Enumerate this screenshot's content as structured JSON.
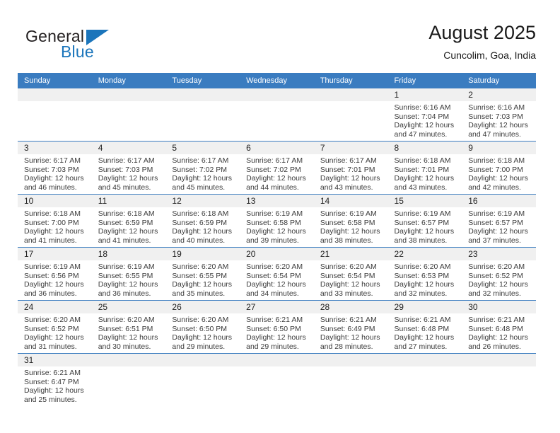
{
  "logo": {
    "word1": "General",
    "word2": "Blue",
    "flag_icon": "blue-triangle-flag-icon",
    "accent_color": "#1b75bb"
  },
  "header": {
    "title": "August 2025",
    "location": "Cuncolim, Goa, India"
  },
  "calendar": {
    "header_bg": "#3a7cc0",
    "daynum_bg": "#f0f0f0",
    "weekdays": [
      "Sunday",
      "Monday",
      "Tuesday",
      "Wednesday",
      "Thursday",
      "Friday",
      "Saturday"
    ],
    "weeks": [
      [
        {
          "day": "",
          "sunrise": "",
          "sunset": "",
          "daylight1": "",
          "daylight2": ""
        },
        {
          "day": "",
          "sunrise": "",
          "sunset": "",
          "daylight1": "",
          "daylight2": ""
        },
        {
          "day": "",
          "sunrise": "",
          "sunset": "",
          "daylight1": "",
          "daylight2": ""
        },
        {
          "day": "",
          "sunrise": "",
          "sunset": "",
          "daylight1": "",
          "daylight2": ""
        },
        {
          "day": "",
          "sunrise": "",
          "sunset": "",
          "daylight1": "",
          "daylight2": ""
        },
        {
          "day": "1",
          "sunrise": "Sunrise: 6:16 AM",
          "sunset": "Sunset: 7:04 PM",
          "daylight1": "Daylight: 12 hours",
          "daylight2": "and 47 minutes."
        },
        {
          "day": "2",
          "sunrise": "Sunrise: 6:16 AM",
          "sunset": "Sunset: 7:03 PM",
          "daylight1": "Daylight: 12 hours",
          "daylight2": "and 47 minutes."
        }
      ],
      [
        {
          "day": "3",
          "sunrise": "Sunrise: 6:17 AM",
          "sunset": "Sunset: 7:03 PM",
          "daylight1": "Daylight: 12 hours",
          "daylight2": "and 46 minutes."
        },
        {
          "day": "4",
          "sunrise": "Sunrise: 6:17 AM",
          "sunset": "Sunset: 7:03 PM",
          "daylight1": "Daylight: 12 hours",
          "daylight2": "and 45 minutes."
        },
        {
          "day": "5",
          "sunrise": "Sunrise: 6:17 AM",
          "sunset": "Sunset: 7:02 PM",
          "daylight1": "Daylight: 12 hours",
          "daylight2": "and 45 minutes."
        },
        {
          "day": "6",
          "sunrise": "Sunrise: 6:17 AM",
          "sunset": "Sunset: 7:02 PM",
          "daylight1": "Daylight: 12 hours",
          "daylight2": "and 44 minutes."
        },
        {
          "day": "7",
          "sunrise": "Sunrise: 6:17 AM",
          "sunset": "Sunset: 7:01 PM",
          "daylight1": "Daylight: 12 hours",
          "daylight2": "and 43 minutes."
        },
        {
          "day": "8",
          "sunrise": "Sunrise: 6:18 AM",
          "sunset": "Sunset: 7:01 PM",
          "daylight1": "Daylight: 12 hours",
          "daylight2": "and 43 minutes."
        },
        {
          "day": "9",
          "sunrise": "Sunrise: 6:18 AM",
          "sunset": "Sunset: 7:00 PM",
          "daylight1": "Daylight: 12 hours",
          "daylight2": "and 42 minutes."
        }
      ],
      [
        {
          "day": "10",
          "sunrise": "Sunrise: 6:18 AM",
          "sunset": "Sunset: 7:00 PM",
          "daylight1": "Daylight: 12 hours",
          "daylight2": "and 41 minutes."
        },
        {
          "day": "11",
          "sunrise": "Sunrise: 6:18 AM",
          "sunset": "Sunset: 6:59 PM",
          "daylight1": "Daylight: 12 hours",
          "daylight2": "and 41 minutes."
        },
        {
          "day": "12",
          "sunrise": "Sunrise: 6:18 AM",
          "sunset": "Sunset: 6:59 PM",
          "daylight1": "Daylight: 12 hours",
          "daylight2": "and 40 minutes."
        },
        {
          "day": "13",
          "sunrise": "Sunrise: 6:19 AM",
          "sunset": "Sunset: 6:58 PM",
          "daylight1": "Daylight: 12 hours",
          "daylight2": "and 39 minutes."
        },
        {
          "day": "14",
          "sunrise": "Sunrise: 6:19 AM",
          "sunset": "Sunset: 6:58 PM",
          "daylight1": "Daylight: 12 hours",
          "daylight2": "and 38 minutes."
        },
        {
          "day": "15",
          "sunrise": "Sunrise: 6:19 AM",
          "sunset": "Sunset: 6:57 PM",
          "daylight1": "Daylight: 12 hours",
          "daylight2": "and 38 minutes."
        },
        {
          "day": "16",
          "sunrise": "Sunrise: 6:19 AM",
          "sunset": "Sunset: 6:57 PM",
          "daylight1": "Daylight: 12 hours",
          "daylight2": "and 37 minutes."
        }
      ],
      [
        {
          "day": "17",
          "sunrise": "Sunrise: 6:19 AM",
          "sunset": "Sunset: 6:56 PM",
          "daylight1": "Daylight: 12 hours",
          "daylight2": "and 36 minutes."
        },
        {
          "day": "18",
          "sunrise": "Sunrise: 6:19 AM",
          "sunset": "Sunset: 6:55 PM",
          "daylight1": "Daylight: 12 hours",
          "daylight2": "and 36 minutes."
        },
        {
          "day": "19",
          "sunrise": "Sunrise: 6:20 AM",
          "sunset": "Sunset: 6:55 PM",
          "daylight1": "Daylight: 12 hours",
          "daylight2": "and 35 minutes."
        },
        {
          "day": "20",
          "sunrise": "Sunrise: 6:20 AM",
          "sunset": "Sunset: 6:54 PM",
          "daylight1": "Daylight: 12 hours",
          "daylight2": "and 34 minutes."
        },
        {
          "day": "21",
          "sunrise": "Sunrise: 6:20 AM",
          "sunset": "Sunset: 6:54 PM",
          "daylight1": "Daylight: 12 hours",
          "daylight2": "and 33 minutes."
        },
        {
          "day": "22",
          "sunrise": "Sunrise: 6:20 AM",
          "sunset": "Sunset: 6:53 PM",
          "daylight1": "Daylight: 12 hours",
          "daylight2": "and 32 minutes."
        },
        {
          "day": "23",
          "sunrise": "Sunrise: 6:20 AM",
          "sunset": "Sunset: 6:52 PM",
          "daylight1": "Daylight: 12 hours",
          "daylight2": "and 32 minutes."
        }
      ],
      [
        {
          "day": "24",
          "sunrise": "Sunrise: 6:20 AM",
          "sunset": "Sunset: 6:52 PM",
          "daylight1": "Daylight: 12 hours",
          "daylight2": "and 31 minutes."
        },
        {
          "day": "25",
          "sunrise": "Sunrise: 6:20 AM",
          "sunset": "Sunset: 6:51 PM",
          "daylight1": "Daylight: 12 hours",
          "daylight2": "and 30 minutes."
        },
        {
          "day": "26",
          "sunrise": "Sunrise: 6:20 AM",
          "sunset": "Sunset: 6:50 PM",
          "daylight1": "Daylight: 12 hours",
          "daylight2": "and 29 minutes."
        },
        {
          "day": "27",
          "sunrise": "Sunrise: 6:21 AM",
          "sunset": "Sunset: 6:50 PM",
          "daylight1": "Daylight: 12 hours",
          "daylight2": "and 29 minutes."
        },
        {
          "day": "28",
          "sunrise": "Sunrise: 6:21 AM",
          "sunset": "Sunset: 6:49 PM",
          "daylight1": "Daylight: 12 hours",
          "daylight2": "and 28 minutes."
        },
        {
          "day": "29",
          "sunrise": "Sunrise: 6:21 AM",
          "sunset": "Sunset: 6:48 PM",
          "daylight1": "Daylight: 12 hours",
          "daylight2": "and 27 minutes."
        },
        {
          "day": "30",
          "sunrise": "Sunrise: 6:21 AM",
          "sunset": "Sunset: 6:48 PM",
          "daylight1": "Daylight: 12 hours",
          "daylight2": "and 26 minutes."
        }
      ],
      [
        {
          "day": "31",
          "sunrise": "Sunrise: 6:21 AM",
          "sunset": "Sunset: 6:47 PM",
          "daylight1": "Daylight: 12 hours",
          "daylight2": "and 25 minutes."
        },
        {
          "day": "",
          "sunrise": "",
          "sunset": "",
          "daylight1": "",
          "daylight2": ""
        },
        {
          "day": "",
          "sunrise": "",
          "sunset": "",
          "daylight1": "",
          "daylight2": ""
        },
        {
          "day": "",
          "sunrise": "",
          "sunset": "",
          "daylight1": "",
          "daylight2": ""
        },
        {
          "day": "",
          "sunrise": "",
          "sunset": "",
          "daylight1": "",
          "daylight2": ""
        },
        {
          "day": "",
          "sunrise": "",
          "sunset": "",
          "daylight1": "",
          "daylight2": ""
        },
        {
          "day": "",
          "sunrise": "",
          "sunset": "",
          "daylight1": "",
          "daylight2": ""
        }
      ]
    ]
  }
}
